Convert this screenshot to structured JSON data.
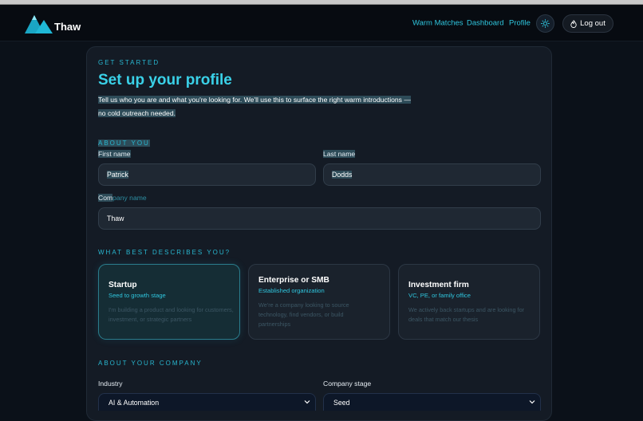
{
  "app": {
    "name": "Thaw"
  },
  "colors": {
    "accent": "#2fc6de",
    "background": "#0b1119",
    "card": "#141b25",
    "selected_border": "#2a7c8c"
  },
  "nav": {
    "links": [
      "Warm Matches",
      "Dashboard",
      "Profile"
    ],
    "theme_icon": "sun-icon",
    "logout_label": "Log out",
    "logout_icon": "flame-icon"
  },
  "header": {
    "eyebrow": "GET STARTED",
    "title": "Set up your profile",
    "intro_line1": "Tell us who you are and what you're looking for. We'll use this to surface the right warm introductions —",
    "intro_line2": "no cold outreach needed."
  },
  "about_you": {
    "heading": "ABOUT YOU",
    "first_name_label": "First name",
    "first_name_value": "Patrick",
    "last_name_label": "Last name",
    "last_name_value": "Dodds",
    "company_label_highlighted": "Com",
    "company_label_rest": "pany name",
    "company_value": "Thaw"
  },
  "describes": {
    "heading": "WHAT BEST DESCRIBES YOU?",
    "options": [
      {
        "title": "Startup",
        "subtitle": "Seed to growth stage",
        "description": "I'm building a product and looking for customers, investment, or strategic partners",
        "selected": true
      },
      {
        "title": "Enterprise or SMB",
        "subtitle": "Established organization",
        "description": "We're a company looking to source technology, find vendors, or build partnerships",
        "selected": false
      },
      {
        "title": "Investment firm",
        "subtitle": "VC, PE, or family office",
        "description": "We actively back startups and are looking for deals that match our thesis",
        "selected": false
      }
    ]
  },
  "about_company": {
    "heading": "ABOUT YOUR COMPANY",
    "industry_label": "Industry",
    "industry_value": "AI & Automation",
    "stage_label": "Company stage",
    "stage_value": "Seed"
  }
}
